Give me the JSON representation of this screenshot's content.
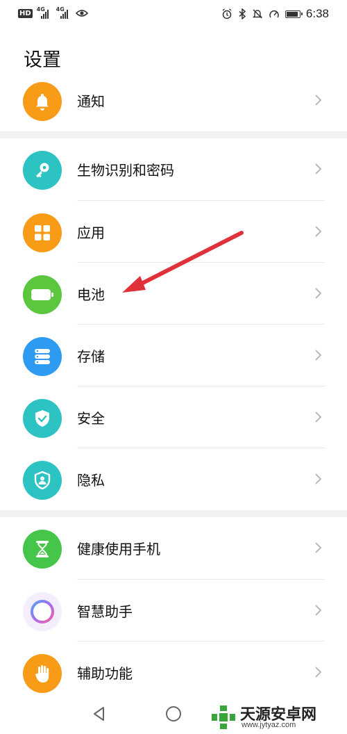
{
  "status_bar": {
    "hd": "HD",
    "net1": "4G",
    "net2": "4G",
    "time": "6:38",
    "battery_level": 0.9
  },
  "page_title": "设置",
  "items": [
    {
      "label": "通知",
      "icon": "bell-icon",
      "color": "#F89B16"
    },
    {
      "label": "生物识别和密码",
      "icon": "key-icon",
      "color": "#2EC3C3"
    },
    {
      "label": "应用",
      "icon": "apps-grid-icon",
      "color": "#F89B16"
    },
    {
      "label": "电池",
      "icon": "battery-icon",
      "color": "#5CC73E"
    },
    {
      "label": "存储",
      "icon": "storage-icon",
      "color": "#2E9BF2"
    },
    {
      "label": "安全",
      "icon": "shield-check-icon",
      "color": "#2EC3C3"
    },
    {
      "label": "隐私",
      "icon": "privacy-shield-icon",
      "color": "#2EC3C3"
    },
    {
      "label": "健康使用手机",
      "icon": "hourglass-icon",
      "color": "#45C54A"
    },
    {
      "label": "智慧助手",
      "icon": "assistant-ring-icon",
      "color": "#A86CF0"
    },
    {
      "label": "辅助功能",
      "icon": "hand-icon",
      "color": "#F89B16"
    }
  ],
  "annotation": {
    "arrow_color": "#E0313A",
    "points_to": "电池"
  },
  "watermark": {
    "text": "天源安卓网",
    "url": "www.jytyaz.com",
    "color": "#3AA53A"
  }
}
